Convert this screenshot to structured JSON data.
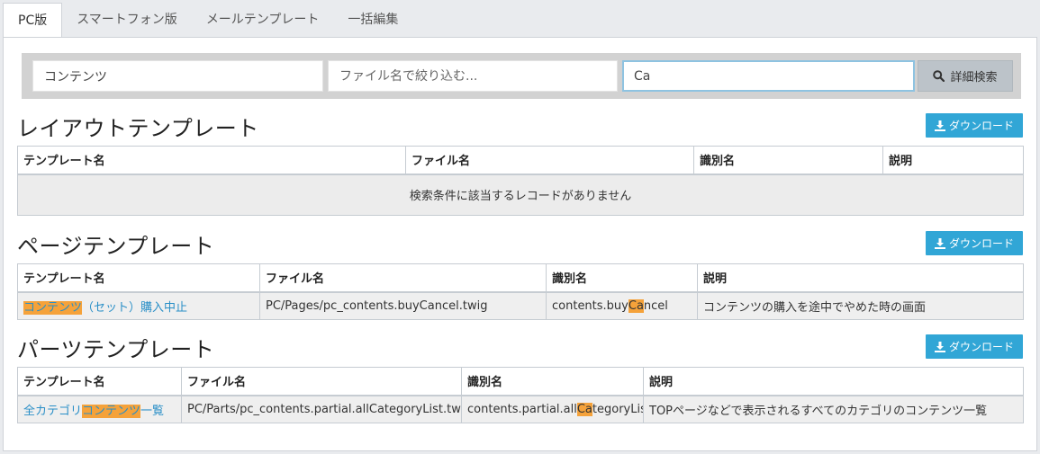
{
  "tabs": [
    {
      "label": "PC版",
      "active": true
    },
    {
      "label": "スマートフォン版",
      "active": false
    },
    {
      "label": "メールテンプレート",
      "active": false
    },
    {
      "label": "一括編集",
      "active": false
    }
  ],
  "search": {
    "category_value": "コンテンツ",
    "filename_placeholder": "ファイル名で絞り込む...",
    "keyword_value": "Ca",
    "button_label": "詳細検索",
    "button_icon": "search-icon"
  },
  "download_label": "ダウンロード",
  "layout_section": {
    "title": "レイアウトテンプレート",
    "headers": [
      "テンプレート名",
      "ファイル名",
      "識別名",
      "説明"
    ],
    "empty_message": "検索条件に該当するレコードがありません"
  },
  "page_section": {
    "title": "ページテンプレート",
    "headers": [
      "テンプレート名",
      "ファイル名",
      "識別名",
      "説明"
    ],
    "row": {
      "name_highlight": "コンテンツ",
      "name_rest": "（セット）購入中止",
      "file": "PC/Pages/pc_contents.buyCancel.twig",
      "id_pre": "contents.buy",
      "id_highlight": "Ca",
      "id_post": "ncel",
      "desc": "コンテンツの購入を途中でやめた時の画面"
    }
  },
  "parts_section": {
    "title": "パーツテンプレート",
    "headers": [
      "テンプレート名",
      "ファイル名",
      "識別名",
      "説明"
    ],
    "row": {
      "name_pre": "全カテゴリ",
      "name_highlight": "コンテンツ",
      "name_post": "一覧",
      "file": "PC/Parts/pc_contents.partial.allCategoryList.twig",
      "id_pre": "contents.partial.all",
      "id_highlight": "Ca",
      "id_post": "tegoryList",
      "desc": "TOPページなどで表示されるすべてのカテゴリのコンテンツ一覧"
    }
  },
  "colors": {
    "accent": "#31a6d6",
    "link": "#2a8fc7",
    "highlight": "#f5a23a"
  }
}
